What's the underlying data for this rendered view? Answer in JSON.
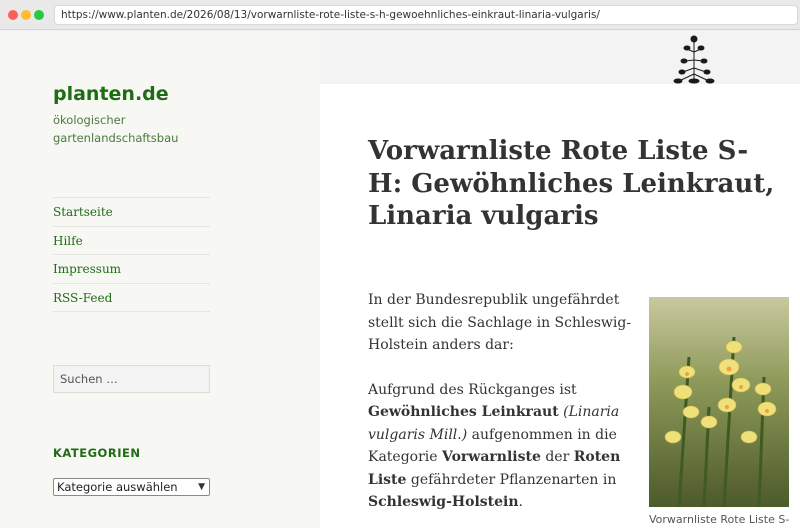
{
  "browser": {
    "url": "https://www.planten.de/2026/08/13/vorwarnliste-rote-liste-s-h-gewoehnliches-einkraut-linaria-vulgaris/"
  },
  "site": {
    "title": "planten.de",
    "description": "ökologischer gartenlandschaftsbau"
  },
  "nav": {
    "items": [
      {
        "label": "Startseite"
      },
      {
        "label": "Hilfe"
      },
      {
        "label": "Impressum"
      },
      {
        "label": "RSS-Feed"
      }
    ]
  },
  "search": {
    "placeholder": "Suchen …"
  },
  "categories": {
    "heading": "KATEGORIEN",
    "selected": "Kategorie auswählen"
  },
  "post": {
    "title": "Vorwarnliste Rote Liste S-H: Gewöhnliches Leinkraut, Linaria vulgaris",
    "para1": "In der Bundesrepublik ungefährdet stellt sich die Sachlage in Schleswig-Holstein anders dar:",
    "p2_text1": "Aufgrund des Rückganges ist ",
    "p2_bold1": "Gewöhnliches Leinkraut",
    "p2_italic1": " (Linaria vulgaris Mill.)",
    "p2_text2": " aufgenommen in die Kategorie ",
    "p2_bold2": "Vorwarnliste",
    "p2_text3": " der ",
    "p2_bold3": "Roten Liste",
    "p2_text4": " gefährdeter Pflanzenarten in ",
    "p2_bold4": "Schleswig-Holstein",
    "p2_text5": "."
  },
  "figure": {
    "caption": "Vorwarnliste Rote Liste S-"
  },
  "colors": {
    "accent": "#1f6b16",
    "flower": "#efe07a"
  }
}
